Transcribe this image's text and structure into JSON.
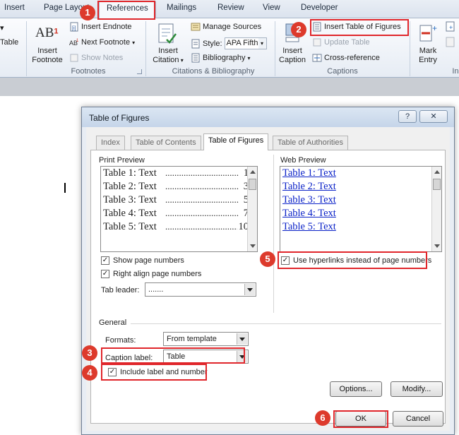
{
  "ribbon": {
    "tabs": [
      "Insert",
      "Page Layout",
      "References",
      "Mailings",
      "Review",
      "View",
      "Developer"
    ],
    "left_fragment": "Table",
    "footnotes": {
      "insert_footnote_line1": "Insert",
      "insert_footnote_line2": "Footnote",
      "ab_glyph": "AB",
      "insert_endnote": "Insert Endnote",
      "next_footnote": "Next Footnote",
      "show_notes": "Show Notes",
      "group_label": "Footnotes"
    },
    "citations": {
      "insert_citation_line1": "Insert",
      "insert_citation_line2": "Citation",
      "manage_sources": "Manage Sources",
      "style_label": "Style:",
      "style_value": "APA Fifth",
      "bibliography": "Bibliography",
      "group_label": "Citations & Bibliography"
    },
    "captions": {
      "insert_caption_line1": "Insert",
      "insert_caption_line2": "Caption",
      "insert_table_of_figures": "Insert Table of Figures",
      "update_table": "Update Table",
      "cross_reference": "Cross-reference",
      "group_label": "Captions"
    },
    "index": {
      "mark_entry_line1": "Mark",
      "mark_entry_line2": "Entry",
      "group_fragment": "In"
    }
  },
  "dialog": {
    "title": "Table of Figures",
    "help_glyph": "?",
    "close_glyph": "✕",
    "tabs": [
      "Index",
      "Table of Contents",
      "Table of Figures",
      "Table of Authorities"
    ],
    "print_preview": {
      "label": "Print Preview",
      "entries": [
        {
          "label": "Table 1: Text",
          "page": "1"
        },
        {
          "label": "Table 2: Text",
          "page": "3"
        },
        {
          "label": "Table 3: Text",
          "page": "5"
        },
        {
          "label": "Table 4: Text",
          "page": "7"
        },
        {
          "label": "Table 5: Text",
          "page": "10"
        }
      ]
    },
    "web_preview": {
      "label": "Web Preview",
      "entries": [
        "Table 1: Text",
        "Table 2: Text",
        "Table 3: Text",
        "Table 4: Text",
        "Table 5: Text"
      ]
    },
    "show_page_numbers": {
      "label": "Show page numbers",
      "checked": true
    },
    "right_align_page_numbers": {
      "label": "Right align page numbers",
      "checked": true
    },
    "use_hyperlinks": {
      "label": "Use hyperlinks instead of page numbers",
      "checked": true
    },
    "tab_leader": {
      "label": "Tab leader:",
      "value": "......."
    },
    "general": {
      "label": "General",
      "formats_label": "Formats:",
      "formats_value": "From template",
      "caption_label_label": "Caption label:",
      "caption_label_value": "Table",
      "include_label": {
        "label": "Include label and number",
        "checked": true
      }
    },
    "buttons": {
      "options": "Options...",
      "modify": "Modify...",
      "ok": "OK",
      "cancel": "Cancel"
    },
    "check_glyph": "✓"
  },
  "annotations": [
    "1",
    "2",
    "3",
    "4",
    "5",
    "6"
  ],
  "colors": {
    "annotation": "#e0262b",
    "badge": "#dd3a2c",
    "hyperlink": "#0b22c8"
  }
}
